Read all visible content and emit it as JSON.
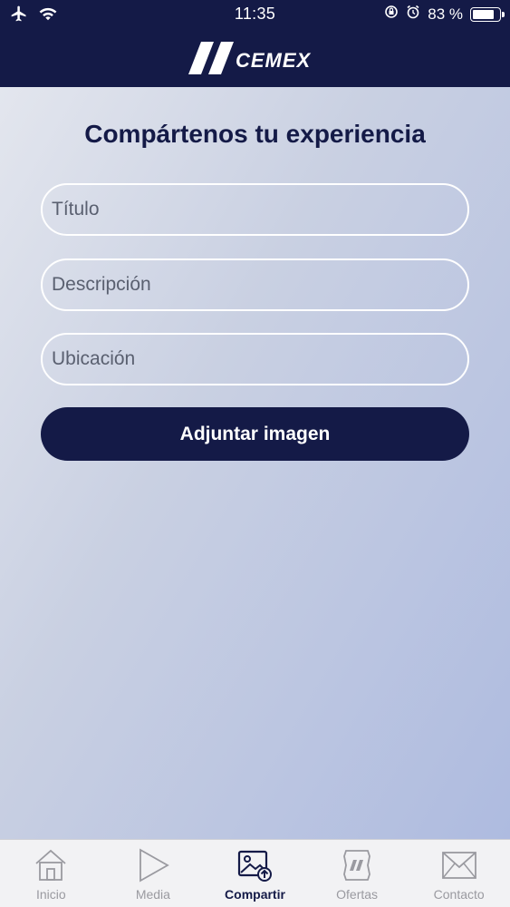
{
  "status_bar": {
    "time": "11:35",
    "battery_percent": "83 %",
    "battery_level": 0.83,
    "icons": [
      "airplane-icon",
      "wifi-icon",
      "orientation-lock-icon",
      "alarm-icon",
      "battery-icon"
    ]
  },
  "header": {
    "logo_text": "CEMEX"
  },
  "main": {
    "title": "Compártenos tu experiencia",
    "fields": [
      {
        "placeholder": "Título",
        "value": ""
      },
      {
        "placeholder": "Descripción",
        "value": ""
      },
      {
        "placeholder": "Ubicación",
        "value": ""
      }
    ],
    "attach_button": "Adjuntar imagen"
  },
  "tabbar": {
    "items": [
      {
        "label": "Inicio",
        "icon": "home-icon",
        "active": false
      },
      {
        "label": "Media",
        "icon": "play-icon",
        "active": false
      },
      {
        "label": "Compartir",
        "icon": "image-upload-icon",
        "active": true
      },
      {
        "label": "Ofertas",
        "icon": "offers-icon",
        "active": false
      },
      {
        "label": "Contacto",
        "icon": "mail-icon",
        "active": false
      }
    ]
  },
  "colors": {
    "brand_navy": "#141a47",
    "background_gradient_start": "#e3e6ee",
    "background_gradient_end": "#aebbe0",
    "field_border": "#ffffff",
    "tab_inactive": "#9a9aa0"
  }
}
